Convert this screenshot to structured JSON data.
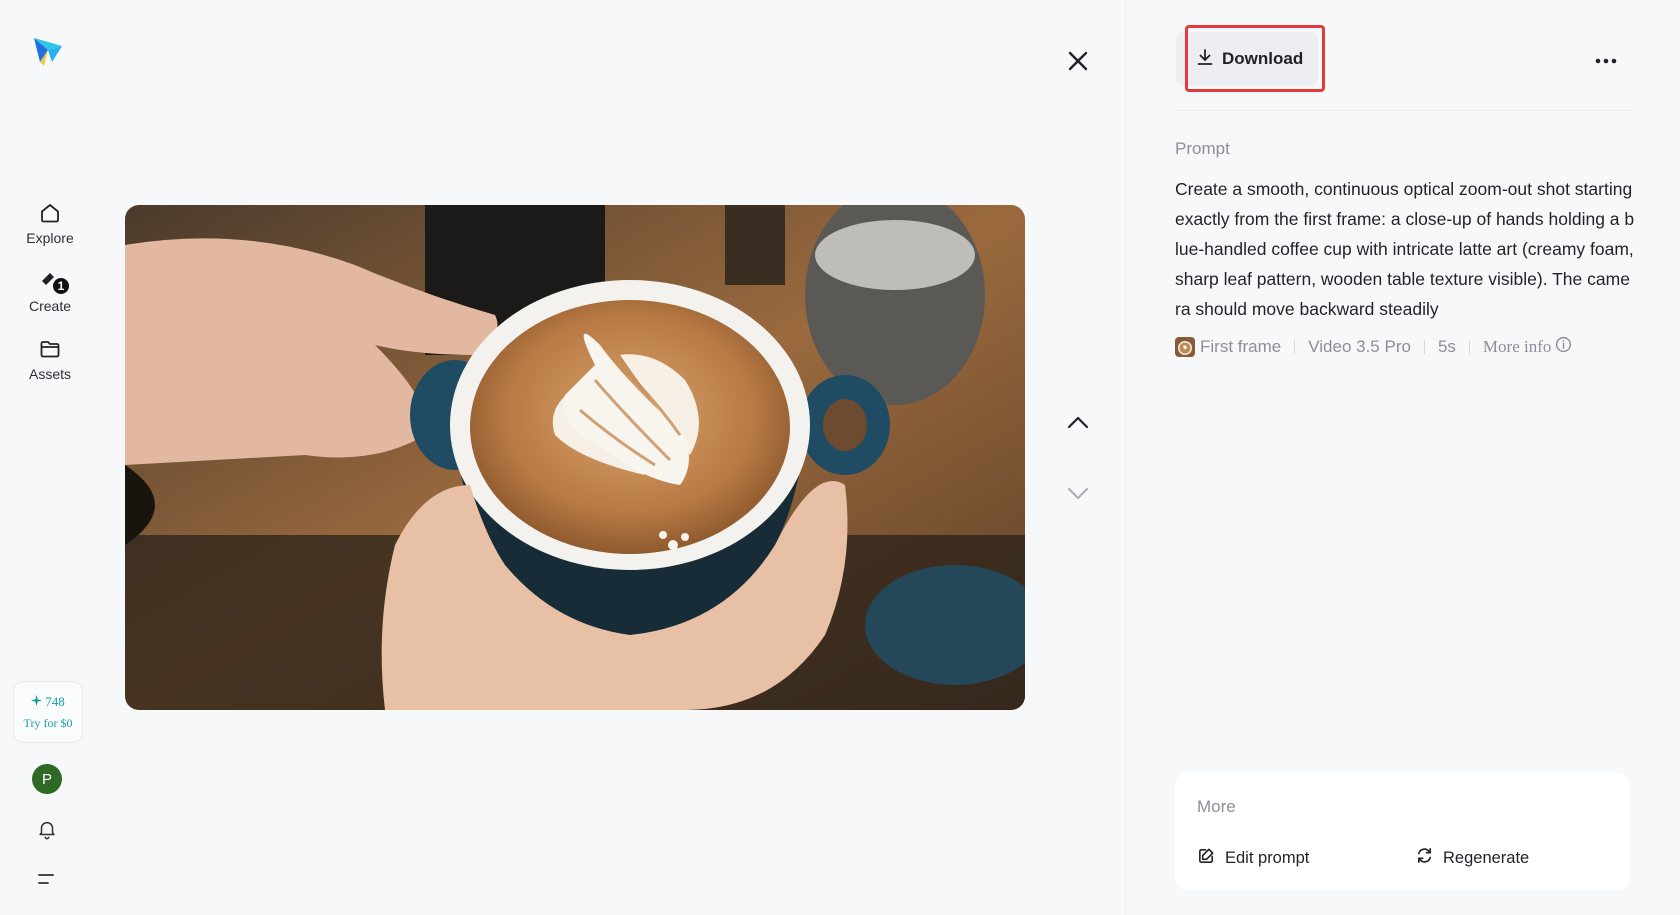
{
  "sidebar": {
    "items": [
      {
        "label": "Explore",
        "icon": "home-icon"
      },
      {
        "label": "Create",
        "icon": "create-icon",
        "badge": "1"
      },
      {
        "label": "Assets",
        "icon": "folder-icon"
      }
    ],
    "credits": {
      "count": "748",
      "cta": "Try for $0"
    },
    "avatar_initial": "P"
  },
  "toolbar": {
    "download_label": "Download"
  },
  "prompt": {
    "label": "Prompt",
    "text": "Create a smooth, continuous optical zoom-out shot starting exactly from the first frame: a close-up of hands holding a blue-handled coffee cup with intricate latte art (creamy foam, sharp leaf pattern, wooden table texture visible). The camera should move backward steadily"
  },
  "meta": {
    "frame_label": "First frame",
    "model": "Video 3.5 Pro",
    "duration": "5s",
    "more_info": "More info"
  },
  "more": {
    "title": "More",
    "edit_label": "Edit prompt",
    "regenerate_label": "Regenerate"
  },
  "colors": {
    "accent_teal": "#13a3a3",
    "download_highlight": "#e23b3b",
    "avatar_bg": "#2e6a26"
  }
}
